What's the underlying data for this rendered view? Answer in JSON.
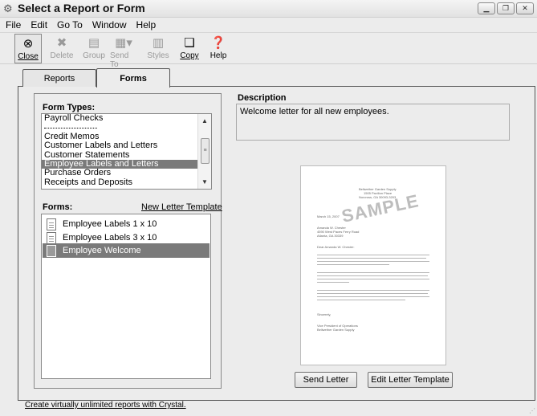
{
  "window": {
    "title": "Select a Report or Form",
    "controls": [
      "minimize-icon",
      "restore-icon",
      "close-icon"
    ]
  },
  "menu": [
    "File",
    "Edit",
    "Go To",
    "Window",
    "Help"
  ],
  "toolbar": {
    "close": "Close",
    "delete": "Delete",
    "group": "Group",
    "send_to": "Send To",
    "styles": "Styles",
    "copy": "Copy",
    "help": "Help"
  },
  "tabs": {
    "reports": "Reports",
    "forms": "Forms",
    "active": "Forms"
  },
  "form_types": {
    "label": "Form Types:",
    "items": [
      "Payroll Checks",
      "---",
      "Credit Memos",
      "Customer Labels and Letters",
      "Customer Statements",
      "Employee Labels and Letters",
      "Purchase Orders",
      "Receipts and Deposits"
    ],
    "selected": "Employee Labels and Letters"
  },
  "forms": {
    "label": "Forms:",
    "new_template_link": "New Letter Template",
    "items": [
      "Employee Labels 1 x 10",
      "Employee Labels 3 x 10",
      "Employee Welcome"
    ],
    "selected": "Employee Welcome"
  },
  "description": {
    "label": "Description",
    "text": "Welcome letter for all new employees."
  },
  "preview": {
    "stamp": "SAMPLE",
    "company": "Bellwether Garden Supply",
    "address1": "1505 Pavilion Place",
    "address2": "Norcross, GA 30093-3203",
    "date": "March 15, 2007",
    "recipient1": "Amanda W. Chester",
    "recipient2": "4590 West Paces Ferry Road",
    "recipient3": "Atlanta, GA 30339",
    "salutation": "Dear Amanda W. Chester:",
    "closing": "Sincerely,",
    "signer1": "Vice President of Operations",
    "signer2": "Bellwether Garden Supply"
  },
  "buttons": {
    "send_letter": "Send Letter",
    "edit_template": "Edit Letter Template"
  },
  "status": {
    "link": "Create virtually unlimited reports with Crystal."
  }
}
